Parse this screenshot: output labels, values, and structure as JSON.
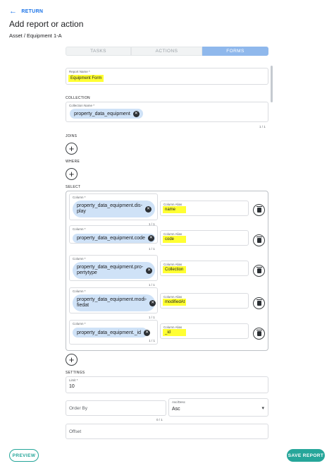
{
  "header": {
    "return_label": "RETURN",
    "title": "Add report or action",
    "breadcrumb": "Asset / Equipment 1-A"
  },
  "tabs": [
    {
      "label": "TASKS",
      "active": false
    },
    {
      "label": "ACTIONS",
      "active": false
    },
    {
      "label": "FORMS",
      "active": true
    }
  ],
  "report_name": {
    "label": "Report Name *",
    "value": "Equipment Form"
  },
  "collection": {
    "section_label": "COLLECTION",
    "field_label": "Collection Name *",
    "chip": "property_data_equipment",
    "count": "1 / 1"
  },
  "joins": {
    "section_label": "JOINS"
  },
  "where": {
    "section_label": "WHERE"
  },
  "select": {
    "section_label": "SELECT",
    "column_label": "Column *",
    "alias_label": "Column Alias",
    "rows": [
      {
        "column_line1": "property_data_equipment.dis-",
        "column_line2": "play",
        "alias": "name",
        "count": "1 / 1"
      },
      {
        "column_line1": "property_data_equipment.code",
        "column_line2": "",
        "alias": "code",
        "count": "1 / 1"
      },
      {
        "column_line1": "property_data_equipment.pro-",
        "column_line2": "pertytype",
        "alias": "Collection",
        "count": "1 / 1"
      },
      {
        "column_line1": "property_data_equipment.modi-",
        "column_line2": "fiedat",
        "alias": "modifiedAt",
        "count": "1 / 1"
      },
      {
        "column_line1": "property_data_equipment._id",
        "column_line2": "",
        "alias": "_id",
        "count": "1 / 1"
      }
    ]
  },
  "settings": {
    "section_label": "SETTINGS",
    "limit_label": "Limit *",
    "limit_value": "10",
    "order_by_placeholder": "Order By",
    "order_by_count": "0 / 1",
    "asc_desc_label": "Asc/Desc",
    "asc_desc_value": "Asc",
    "offset_placeholder": "Offset"
  },
  "footer": {
    "preview_label": "PREVIEW",
    "save_label": "SAVE REPORT"
  },
  "colors": {
    "accent": "#1a73e8",
    "teal": "#26a69a",
    "chip": "#cfe2f7",
    "highlight": "#ffff33"
  }
}
